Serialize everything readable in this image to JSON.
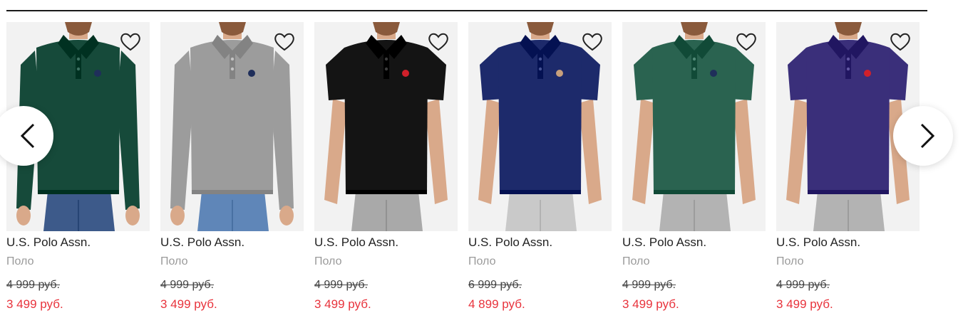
{
  "products": [
    {
      "brand": "U.S. Polo Assn.",
      "category": "Поло",
      "old_price": "4 999 руб.",
      "new_price": "3 499 руб.",
      "shirt_color": "#164a3a",
      "pants_color": "#3d5a8a",
      "sleeves": "long",
      "logo_color": "#1f2e5a"
    },
    {
      "brand": "U.S. Polo Assn.",
      "category": "Поло",
      "old_price": "4 999 руб.",
      "new_price": "3 499 руб.",
      "shirt_color": "#9c9c9c",
      "pants_color": "#5f86b8",
      "sleeves": "long",
      "logo_color": "#1f2e5a"
    },
    {
      "brand": "U.S. Polo Assn.",
      "category": "Поло",
      "old_price": "4 999 руб.",
      "new_price": "3 499 руб.",
      "shirt_color": "#141414",
      "pants_color": "#a9a9a9",
      "sleeves": "short",
      "logo_color": "#d0202a"
    },
    {
      "brand": "U.S. Polo Assn.",
      "category": "Поло",
      "old_price": "6 999 руб.",
      "new_price": "4 899 руб.",
      "shirt_color": "#1d2a6b",
      "pants_color": "#c9c9c9",
      "sleeves": "short",
      "logo_color": "#c8a07c"
    },
    {
      "brand": "U.S. Polo Assn.",
      "category": "Поло",
      "old_price": "4 999 руб.",
      "new_price": "3 499 руб.",
      "shirt_color": "#2a6350",
      "pants_color": "#b3b3b3",
      "sleeves": "short",
      "logo_color": "#1f2e5a"
    },
    {
      "brand": "U.S. Polo Assn.",
      "category": "Поло",
      "old_price": "4 999 руб.",
      "new_price": "3 499 руб.",
      "shirt_color": "#3a2f7a",
      "pants_color": "#b3b3b3",
      "sleeves": "short",
      "logo_color": "#d0202a"
    }
  ],
  "icons": {
    "wishlist": "heart-outline-icon",
    "prev": "chevron-left-icon",
    "next": "chevron-right-icon"
  },
  "colors": {
    "sale_price": "#e8333c",
    "muted_text": "#9a9a9a",
    "photo_bg": "#f2f2f2"
  }
}
